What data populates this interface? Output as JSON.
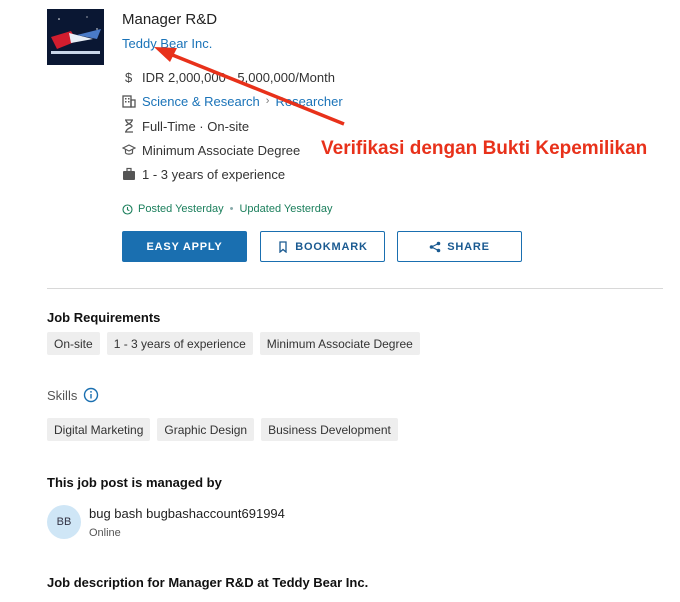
{
  "job": {
    "title": "Manager R&D",
    "company": "Teddy Bear Inc.",
    "salary": "IDR  2,000,000 - 5,000,000/Month",
    "category": "Science & Research",
    "subcategory": "Researcher",
    "employment": "Full-Time · On-site",
    "education": "Minimum Associate Degree",
    "experience": "1 - 3 years of experience",
    "posted": "Posted Yesterday",
    "updated": "Updated Yesterday"
  },
  "buttons": {
    "apply": "EASY APPLY",
    "bookmark": "BOOKMARK",
    "share": "SHARE"
  },
  "requirements": {
    "heading": "Job Requirements",
    "chips": [
      "On-site",
      "1 - 3 years of experience",
      "Minimum Associate Degree"
    ]
  },
  "skills": {
    "heading": "Skills",
    "chips": [
      "Digital Marketing",
      "Graphic Design",
      "Business Development"
    ]
  },
  "manager": {
    "heading": "This job post is managed by",
    "initials": "BB",
    "name": "bug bash bugbashaccount691994",
    "status": "Online"
  },
  "description": {
    "heading": "Job description for Manager R&D at Teddy Bear Inc."
  },
  "annotation": {
    "text": "Verifikasi dengan Bukti Kepemilikan",
    "color": "#e8311a"
  },
  "colors": {
    "accent": "#1a6fb0",
    "link": "#1a73b8",
    "posted": "#1b7f5c"
  }
}
